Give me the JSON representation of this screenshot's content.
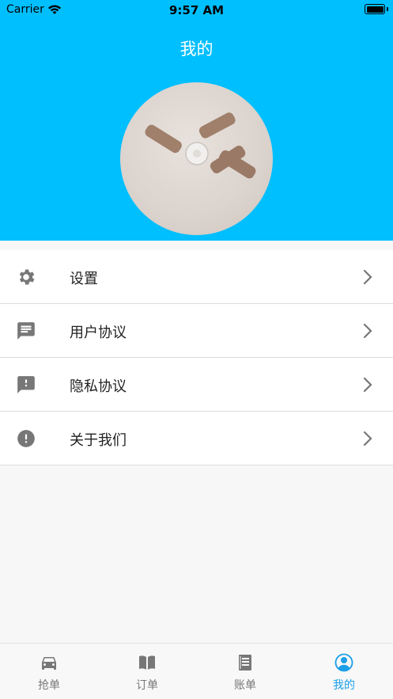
{
  "status_bar": {
    "carrier": "Carrier",
    "time": "9:57 AM"
  },
  "header": {
    "title": "我的"
  },
  "menu": [
    {
      "label": "设置",
      "icon": "gear-icon"
    },
    {
      "label": "用户协议",
      "icon": "chat-bubble-icon"
    },
    {
      "label": "隐私协议",
      "icon": "alert-bubble-icon"
    },
    {
      "label": "关于我们",
      "icon": "alert-circle-icon"
    }
  ],
  "tabbar": {
    "active_color": "#1a9fe8",
    "inactive_color": "#777777",
    "tabs": [
      {
        "label": "抢单",
        "icon": "car-icon",
        "active": false
      },
      {
        "label": "订单",
        "icon": "book-icon",
        "active": false
      },
      {
        "label": "账单",
        "icon": "ledger-icon",
        "active": false
      },
      {
        "label": "我的",
        "icon": "user-circle-icon",
        "active": true
      }
    ]
  },
  "colors": {
    "header_bg": "#00bfff",
    "page_bg": "#f7f7f7",
    "icon_gray": "#777777"
  }
}
